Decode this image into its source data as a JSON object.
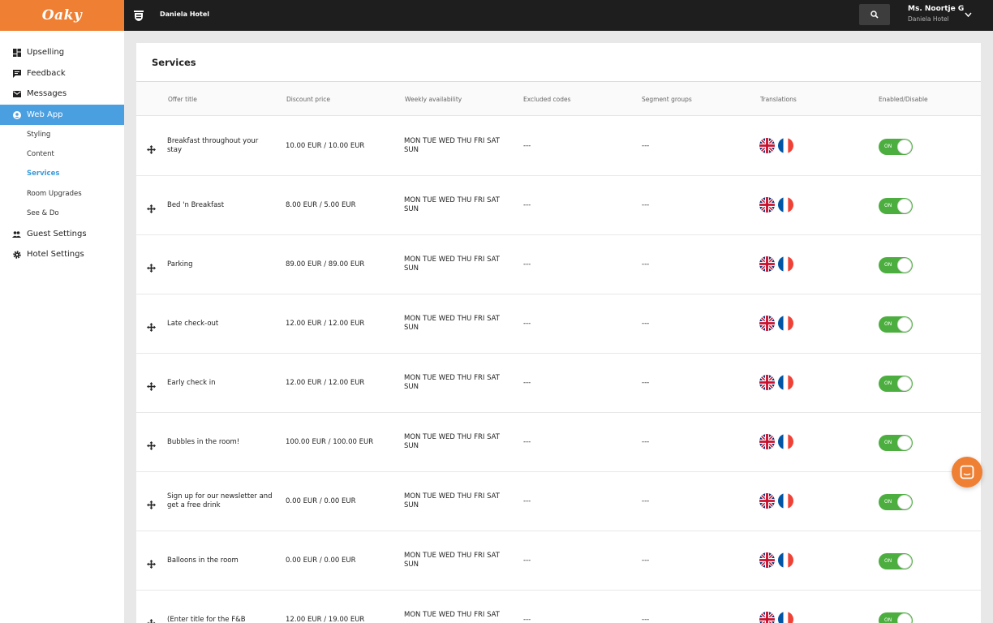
{
  "topbar": {
    "logo": "Oaky",
    "hotel_name": "Daniela Hotel",
    "user_name": "Ms. Noortje G",
    "user_hotel": "Daniela Hotel"
  },
  "sidebar": {
    "items": [
      {
        "label": "Upselling",
        "icon": "dashboard-icon"
      },
      {
        "label": "Feedback",
        "icon": "chat-bubble-icon"
      },
      {
        "label": "Messages",
        "icon": "envelope-icon"
      },
      {
        "label": "Web App",
        "icon": "user-circle-icon",
        "active": true
      },
      {
        "label": "Guest Settings",
        "icon": "people-icon"
      },
      {
        "label": "Hotel Settings",
        "icon": "gear-icon"
      }
    ],
    "subitems": [
      {
        "label": "Styling"
      },
      {
        "label": "Content"
      },
      {
        "label": "Services",
        "active": true
      },
      {
        "label": "Room Upgrades"
      },
      {
        "label": "See & Do"
      }
    ]
  },
  "main": {
    "title": "Services",
    "columns": [
      "Offer title",
      "Discount price",
      "Weekly availability",
      "Excluded codes",
      "Segment groups",
      "Translations",
      "Enabled/Disable"
    ],
    "toggle_label": "ON",
    "rows": [
      {
        "title": "Breakfast throughout your stay",
        "price": "10.00 EUR / 10.00 EUR",
        "availability": "MON TUE WED THU FRI SAT SUN",
        "excluded": "---",
        "segments": "---"
      },
      {
        "title": "Bed 'n Breakfast",
        "price": "8.00 EUR / 5.00 EUR",
        "availability": "MON TUE WED THU FRI SAT SUN",
        "excluded": "---",
        "segments": "---"
      },
      {
        "title": "Parking",
        "price": "89.00 EUR / 89.00 EUR",
        "availability": "MON TUE WED THU FRI SAT SUN",
        "excluded": "---",
        "segments": "---"
      },
      {
        "title": "Late check-out",
        "price": "12.00 EUR / 12.00 EUR",
        "availability": "MON TUE WED THU FRI SAT SUN",
        "excluded": "---",
        "segments": "---"
      },
      {
        "title": "Early check in",
        "price": "12.00 EUR / 12.00 EUR",
        "availability": "MON TUE WED THU FRI SAT SUN",
        "excluded": "---",
        "segments": "---"
      },
      {
        "title": "Bubbles in the room!",
        "price": "100.00 EUR / 100.00 EUR",
        "availability": "MON TUE WED THU FRI SAT SUN",
        "excluded": "---",
        "segments": "---"
      },
      {
        "title": "Sign up for our newsletter and get a free drink",
        "price": "0.00 EUR / 0.00 EUR",
        "availability": "MON TUE WED THU FRI SAT SUN",
        "excluded": "---",
        "segments": "---"
      },
      {
        "title": "Balloons in the room",
        "price": "0.00 EUR / 0.00 EUR",
        "availability": "MON TUE WED THU FRI SAT SUN",
        "excluded": "---",
        "segments": "---"
      },
      {
        "title": "(Enter title for the F&B",
        "price": "12.00 EUR / 19.00 EUR",
        "availability": "MON TUE WED THU FRI SAT",
        "excluded": "---",
        "segments": "---"
      }
    ]
  },
  "colors": {
    "brand_orange": "#ef7f33",
    "topbar": "#1e1e1e",
    "active_nav": "#4a9fe1",
    "toggle_on": "#4cae3f"
  }
}
